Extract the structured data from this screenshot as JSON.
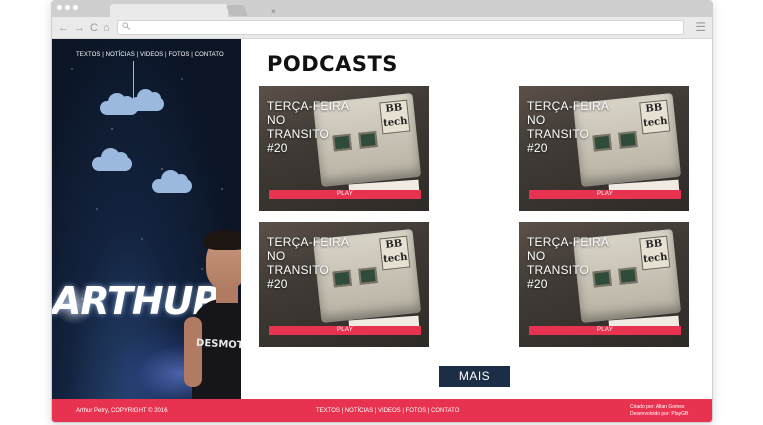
{
  "browser": {
    "tab_close": "×",
    "nav_back": "←",
    "nav_forward": "→",
    "nav_reload": "C",
    "nav_home": "⌂",
    "menu": "☰"
  },
  "hero": {
    "nav": "TEXTOS | NOTÍCIAS | VIDEOS | FOTOS | CONTATO",
    "name": "ARTHUR",
    "shirt_text": "DESMOT"
  },
  "main": {
    "title": "PODCASTS",
    "cards": [
      {
        "title_lines": [
          "TERÇA-FEIRA",
          "NO",
          "TRANSITO",
          "#20"
        ],
        "play": "PLAY",
        "badge": "BB tech"
      },
      {
        "title_lines": [
          "TERÇA-FEIRA",
          "NO",
          "TRANSITO",
          "#20"
        ],
        "play": "PLAY",
        "badge": "BB tech"
      },
      {
        "title_lines": [
          "TERÇA-FEIRA",
          "NO",
          "TRANSITO",
          "#20"
        ],
        "play": "PLAY",
        "badge": "BB tech"
      },
      {
        "title_lines": [
          "TERÇA-FEIRA",
          "NO",
          "TRANSITO",
          "#20"
        ],
        "play": "PLAY",
        "badge": "BB tech"
      }
    ],
    "more_label": "MAIS"
  },
  "footer": {
    "copyright": "Arthur Petry, COPYRIGHT © 2016",
    "nav": "TEXTOS | NOTÍCIAS | VIDEOS | FOTOS | CONTATO",
    "credit_1": "Criado por: Allan Gomes",
    "credit_2": "Desenvolvido por: PlayGB"
  },
  "colors": {
    "accent": "#e83350",
    "button_dark": "#1c2e45"
  }
}
